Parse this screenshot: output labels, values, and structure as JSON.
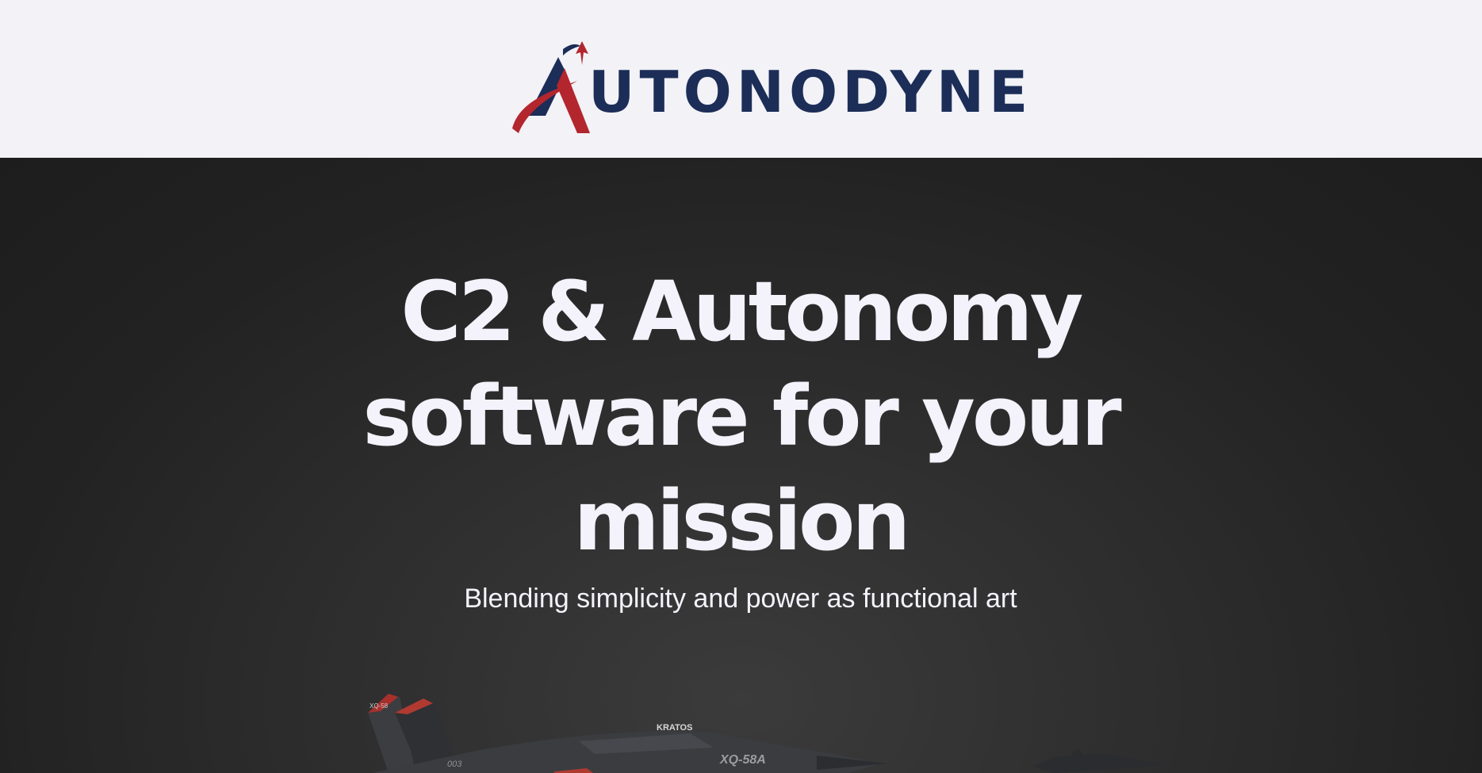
{
  "header": {
    "logo": {
      "text": "UTONODYNE",
      "mark_icon": "autonodyne-a-logo-icon",
      "colors": {
        "navy": "#1c2d57",
        "red": "#b3262d"
      }
    }
  },
  "hero": {
    "headline": "C2 & Autonomy software for your mission",
    "subhead": "Blending simplicity and power as functional art",
    "image": {
      "icon": "drone-aircraft-image",
      "markings": {
        "brand": "KRATOS",
        "model": "XQ-58A",
        "tail_small": "XQ-58",
        "tail_number": "003"
      }
    }
  },
  "colors": {
    "header_bg": "#f2f2f7",
    "hero_bg": "#262626",
    "hero_text": "#f4f2fb"
  }
}
